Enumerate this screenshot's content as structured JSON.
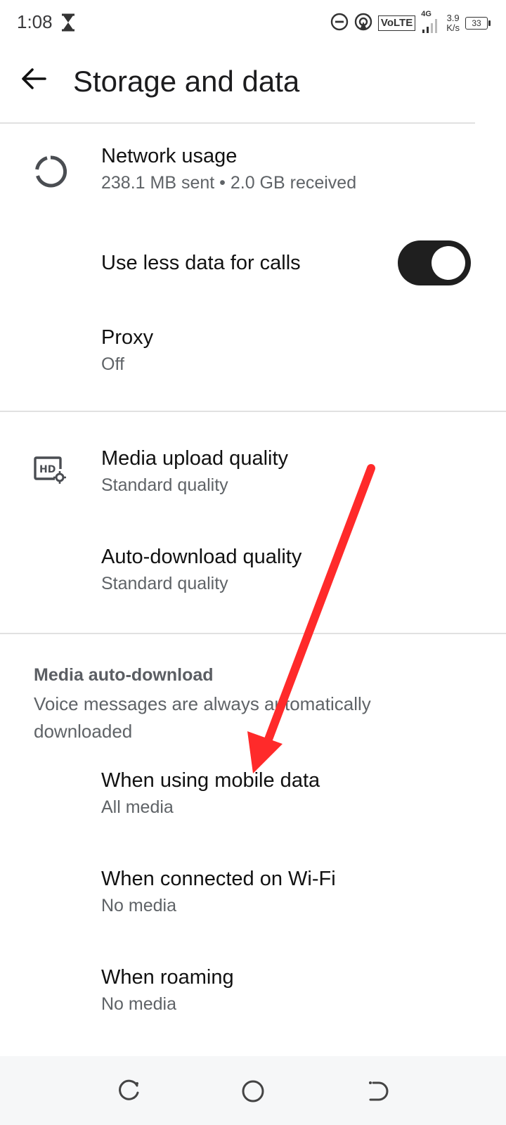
{
  "status_bar": {
    "time": "1:08",
    "network_type": "VoLTE",
    "signal_label": "4G",
    "speed_value": "3.9",
    "speed_unit": "K/s",
    "battery": "33"
  },
  "app_bar": {
    "title": "Storage and data"
  },
  "network": {
    "usage_title": "Network usage",
    "usage_summary": "238.1 MB sent • 2.0 GB received",
    "calls_label": "Use less data for calls",
    "calls_toggle_on": true,
    "proxy_title": "Proxy",
    "proxy_value": "Off"
  },
  "quality": {
    "upload_title": "Media upload quality",
    "upload_value": "Standard quality",
    "auto_title": "Auto-download quality",
    "auto_value": "Standard quality"
  },
  "auto_download": {
    "heading": "Media auto-download",
    "description": "Voice messages are always automatically downloaded",
    "items": [
      {
        "title": "When using mobile data",
        "value": "All media"
      },
      {
        "title": "When connected on Wi-Fi",
        "value": "No media"
      },
      {
        "title": "When roaming",
        "value": "No media"
      }
    ]
  },
  "colors": {
    "accent_arrow": "#ff2a2a",
    "toggle_track": "#1f1f1f"
  },
  "icons": {
    "back": "arrow-left-icon",
    "network_usage": "donut-chart-icon",
    "media_quality": "hd-settings-icon",
    "nav_recents": "recents-icon",
    "nav_home": "home-circle-icon",
    "nav_back": "back-nav-icon"
  }
}
